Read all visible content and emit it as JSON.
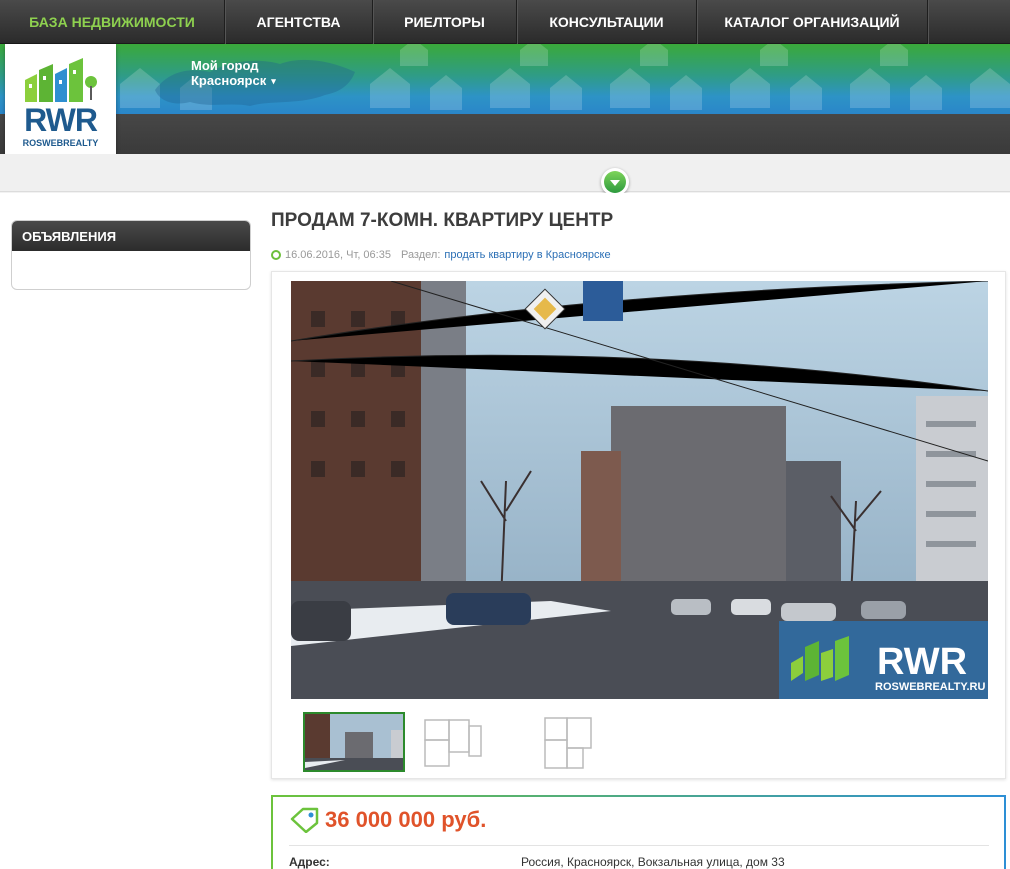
{
  "topnav": {
    "items": [
      {
        "label": "БАЗА НЕДВИЖИМОСТИ",
        "active": true
      },
      {
        "label": "АГЕНТСТВА",
        "active": false
      },
      {
        "label": "РИЕЛТОРЫ",
        "active": false
      },
      {
        "label": "КОНСУЛЬТАЦИИ",
        "active": false
      },
      {
        "label": "КАТАЛОГ ОРГАНИЗАЦИЙ",
        "active": false
      }
    ],
    "active_color": "#8ed14f"
  },
  "header": {
    "logo_text": "RWR",
    "logo_subtext": "ROSWEBREALTY",
    "city_label": "Мой город",
    "city_name": "Красноярск",
    "city_caret": "▾"
  },
  "sidebar": {
    "panel_title": "ОБЪЯВЛЕНИЯ"
  },
  "listing": {
    "title": "ПРОДАМ 7-КОМН. КВАРТИРУ ЦЕНТР",
    "date": "16.06.2016, Чт, 06:35",
    "section_label": "Раздел:",
    "section_link": "продать квартиру в Красноярске",
    "watermark_logo": "RWR",
    "watermark_site": "ROSWEBREALTY.RU",
    "thumbnails": [
      "photo",
      "floorplan-1",
      "floorplan-2"
    ],
    "price": "36 000 000 руб.",
    "address_label": "Адрес:",
    "address_value": "Россия, Красноярск, Вокзальная улица, дом 33"
  },
  "colors": {
    "brand_green": "#6cc33c",
    "brand_blue": "#1e5a8e",
    "price": "#e0532a",
    "link": "#2b6fb5"
  }
}
